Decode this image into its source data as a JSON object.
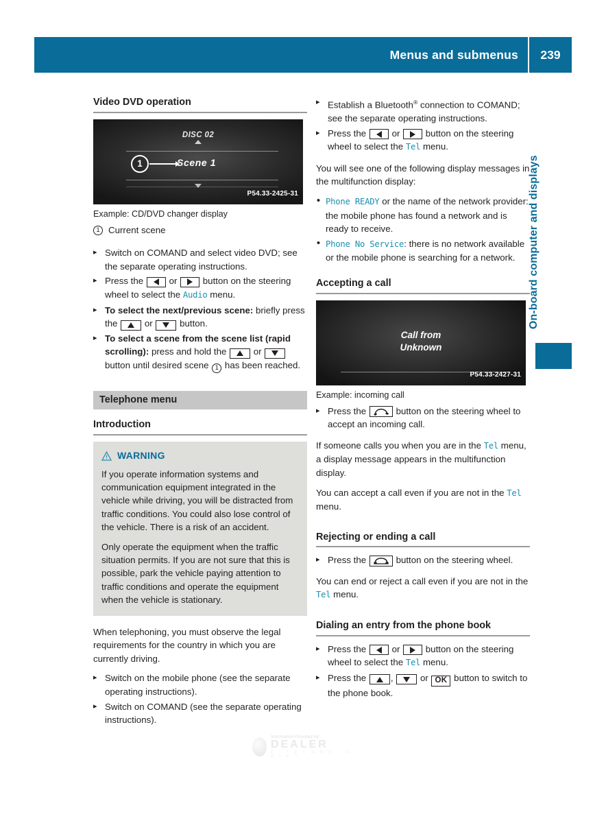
{
  "header": {
    "title": "Menus and submenus",
    "page_number": "239"
  },
  "side_tab": {
    "label": "On-board computer and displays"
  },
  "colors": {
    "brand_blue": "#0a6c99",
    "mono_teal": "#1a8fae",
    "band_gray": "#c6c6c6",
    "warn_bg": "#dededb"
  },
  "left_column": {
    "section_heading": "Video DVD operation",
    "figure": {
      "disc_label": "DISC 02",
      "scene_label": "Scene 1",
      "callout_number": "1",
      "image_code": "P54.33-2425-31",
      "caption": "Example: CD/DVD changer display"
    },
    "legend": [
      {
        "number": "1",
        "text": "Current scene"
      }
    ],
    "steps": [
      {
        "parts": [
          {
            "type": "text",
            "value": "Switch on COMAND and select video DVD; see the separate operating instructions."
          }
        ]
      },
      {
        "parts": [
          {
            "type": "text",
            "value": "Press the "
          },
          {
            "type": "key",
            "value": "arrow-left"
          },
          {
            "type": "text",
            "value": " or "
          },
          {
            "type": "key",
            "value": "arrow-right"
          },
          {
            "type": "text",
            "value": " button on the steering wheel to select the "
          },
          {
            "type": "mono",
            "value": "Audio"
          },
          {
            "type": "text",
            "value": " menu."
          }
        ]
      },
      {
        "parts": [
          {
            "type": "bold",
            "value": "To select the next/previous scene:"
          },
          {
            "type": "text",
            "value": " briefly press the "
          },
          {
            "type": "key",
            "value": "arrow-up"
          },
          {
            "type": "text",
            "value": " or "
          },
          {
            "type": "key",
            "value": "arrow-down"
          },
          {
            "type": "text",
            "value": " button."
          }
        ]
      },
      {
        "parts": [
          {
            "type": "bold",
            "value": "To select a scene from the scene list (rapid scrolling):"
          },
          {
            "type": "text",
            "value": " press and hold the "
          },
          {
            "type": "key",
            "value": "arrow-up"
          },
          {
            "type": "text",
            "value": " or "
          },
          {
            "type": "key",
            "value": "arrow-down"
          },
          {
            "type": "text",
            "value": " button until desired scene "
          },
          {
            "type": "circnum",
            "value": "1"
          },
          {
            "type": "text",
            "value": " has been reached."
          }
        ]
      }
    ],
    "band_heading": "Telephone menu",
    "sub_heading": "Introduction",
    "warning": {
      "title": "WARNING",
      "paragraphs": [
        "If you operate information systems and communication equipment integrated in the vehicle while driving, you will be distracted from traffic conditions. You could also lose control of the vehicle. There is a risk of an accident.",
        "Only operate the equipment when the traffic situation permits. If you are not sure that this is possible, park the vehicle paying attention to traffic conditions and operate the equipment when the vehicle is stationary."
      ]
    },
    "closing_paragraph": "When telephoning, you must observe the legal requirements for the country in which you are currently driving.",
    "closing_steps": [
      "Switch on the mobile phone (see the separate operating instructions).",
      "Switch on COMAND (see the separate operating instructions)."
    ]
  },
  "right_column": {
    "steps_top": [
      {
        "parts": [
          {
            "type": "text",
            "value": "Establish a Bluetooth"
          },
          {
            "type": "sup",
            "value": "®"
          },
          {
            "type": "text",
            "value": " connection to COMAND; see the separate operating instructions."
          }
        ]
      },
      {
        "parts": [
          {
            "type": "text",
            "value": "Press the "
          },
          {
            "type": "key",
            "value": "arrow-left"
          },
          {
            "type": "text",
            "value": " or "
          },
          {
            "type": "key",
            "value": "arrow-right"
          },
          {
            "type": "text",
            "value": " button on the steering wheel to select the "
          },
          {
            "type": "mono",
            "value": "Tel"
          },
          {
            "type": "text",
            "value": " menu."
          }
        ]
      }
    ],
    "intro_paragraph": "You will see one of the following display messages in the multifunction display:",
    "bullets": [
      {
        "parts": [
          {
            "type": "mono",
            "value": "Phone READY"
          },
          {
            "type": "text",
            "value": " or the name of the network provider: the mobile phone has found a network and is ready to receive."
          }
        ]
      },
      {
        "parts": [
          {
            "type": "mono",
            "value": "Phone No Service"
          },
          {
            "type": "text",
            "value": ": there is no network available or the mobile phone is searching for a network."
          }
        ]
      }
    ],
    "accepting": {
      "heading": "Accepting a call",
      "figure": {
        "message_line1": "Call from",
        "message_line2": "Unknown",
        "image_code": "P54.33-2427-31",
        "caption": "Example: incoming call"
      },
      "step": {
        "parts": [
          {
            "type": "text",
            "value": "Press the "
          },
          {
            "type": "key",
            "value": "phone-accept"
          },
          {
            "type": "text",
            "value": " button on the steering wheel to accept an incoming call."
          }
        ]
      },
      "paragraphs": [
        {
          "parts": [
            {
              "type": "text",
              "value": "If someone calls you when you are in the "
            },
            {
              "type": "mono",
              "value": "Tel"
            },
            {
              "type": "text",
              "value": " menu, a display message appears in the multifunction display."
            }
          ]
        },
        {
          "parts": [
            {
              "type": "text",
              "value": "You can accept a call even if you are not in the "
            },
            {
              "type": "mono",
              "value": "Tel"
            },
            {
              "type": "text",
              "value": " menu."
            }
          ]
        }
      ]
    },
    "rejecting": {
      "heading": "Rejecting or ending a call",
      "step": {
        "parts": [
          {
            "type": "text",
            "value": "Press the "
          },
          {
            "type": "key",
            "value": "phone-end"
          },
          {
            "type": "text",
            "value": " button on the steering wheel."
          }
        ]
      },
      "paragraph": {
        "parts": [
          {
            "type": "text",
            "value": "You can end or reject a call even if you are not in the "
          },
          {
            "type": "mono",
            "value": "Tel"
          },
          {
            "type": "text",
            "value": " menu."
          }
        ]
      }
    },
    "dialing": {
      "heading": "Dialing an entry from the phone book",
      "steps": [
        {
          "parts": [
            {
              "type": "text",
              "value": "Press the "
            },
            {
              "type": "key",
              "value": "arrow-left"
            },
            {
              "type": "text",
              "value": " or "
            },
            {
              "type": "key",
              "value": "arrow-right"
            },
            {
              "type": "text",
              "value": " button on the steering wheel to select the "
            },
            {
              "type": "mono",
              "value": "Tel"
            },
            {
              "type": "text",
              "value": " menu."
            }
          ]
        },
        {
          "parts": [
            {
              "type": "text",
              "value": "Press the "
            },
            {
              "type": "key",
              "value": "arrow-up"
            },
            {
              "type": "text",
              "value": ", "
            },
            {
              "type": "key",
              "value": "arrow-down"
            },
            {
              "type": "text",
              "value": " or "
            },
            {
              "type": "key",
              "value": "OK"
            },
            {
              "type": "text",
              "value": " button to switch to the phone book."
            }
          ]
        }
      ]
    }
  },
  "watermark": {
    "line_top": "Information Provided by:",
    "line_main": "DEALER",
    "line_sub": "E - T E C H N O L O G I E S"
  }
}
